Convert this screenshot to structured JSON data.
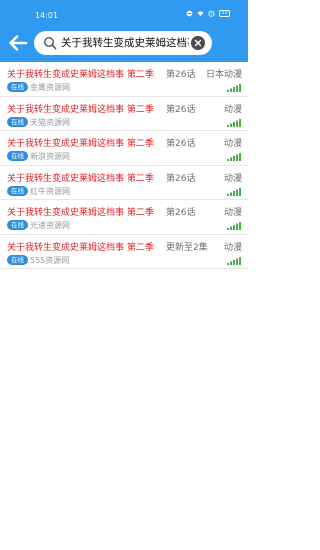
{
  "status_bar": {
    "time": "14:01",
    "battery": "35"
  },
  "search": {
    "value": "关于我转生变成史莱姆这档事"
  },
  "colors": {
    "header": "#2f9af0",
    "title": "#e5252a",
    "badge": "#2f8de0",
    "signal": "#4caf50"
  },
  "results": [
    {
      "title": "关于我转生变成史莱姆这档事 第二季",
      "episode": "第26话",
      "category": "日本动漫",
      "badge": "在线",
      "source": "金鹰资源网"
    },
    {
      "title": "关于我转生变成史莱姆这档事 第二季",
      "episode": "第26话",
      "category": "动漫",
      "badge": "在线",
      "source": "天猫资源网"
    },
    {
      "title": "关于我转生变成史莱姆这档事 第二季",
      "episode": "第26话",
      "category": "动漫",
      "badge": "在线",
      "source": "新浪资源网"
    },
    {
      "title": "关于我转生变成史莱姆这档事 第二季",
      "episode": "第26话",
      "category": "动漫",
      "badge": "在线",
      "source": "红牛资源网"
    },
    {
      "title": "关于我转生变成史莱姆这档事 第二季",
      "episode": "第26话",
      "category": "动漫",
      "badge": "在线",
      "source": "光速资源网"
    },
    {
      "title": "关于我转生变成史莱姆这档事 第二季",
      "episode": "更新至2集",
      "category": "动漫",
      "badge": "在线",
      "source": "555资源网"
    }
  ]
}
